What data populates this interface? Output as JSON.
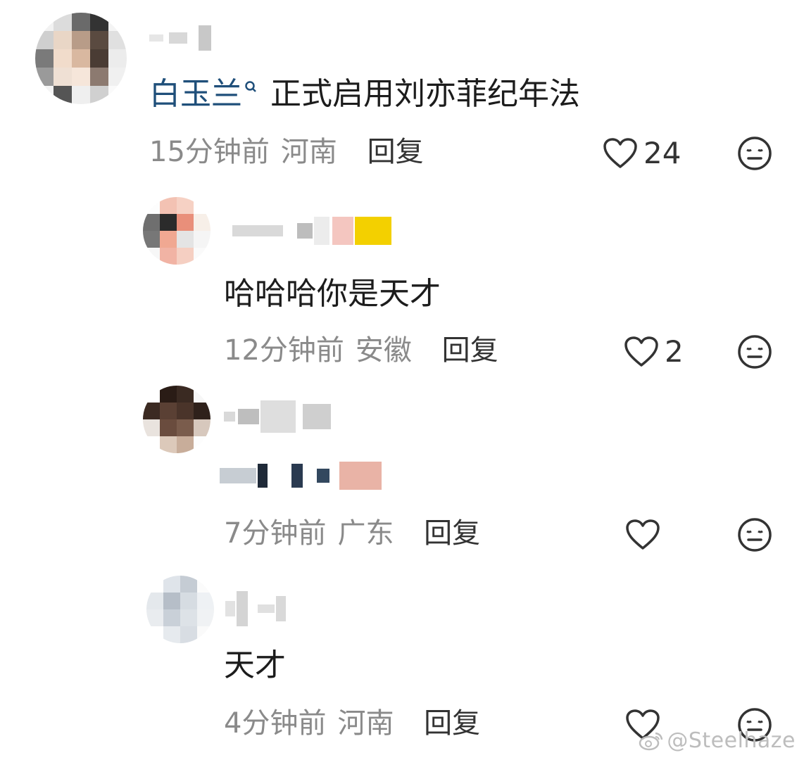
{
  "comments": [
    {
      "mention": "白玉兰",
      "text": "正式启用刘亦菲纪年法",
      "time": "15分钟前",
      "location": "河南",
      "reply_label": "回复",
      "likes": "24"
    },
    {
      "text": "哈哈哈你是天才",
      "time": "12分钟前",
      "location": "安徽",
      "reply_label": "回复",
      "likes": "2"
    },
    {
      "text": "",
      "time": "7分钟前",
      "location": "广东",
      "reply_label": "回复",
      "likes": ""
    },
    {
      "text": "天才",
      "time": "4分钟前",
      "location": "河南",
      "reply_label": "回复",
      "likes": ""
    }
  ],
  "watermark": "@Steelhaze",
  "icons": {
    "like": "heart-outline-icon",
    "dislike": "meh-face-icon",
    "mention": "search-icon",
    "watermark": "weibo-logo-icon"
  },
  "colors": {
    "mention": "#1f4f7a",
    "meta": "#8a8a8a",
    "text": "#1c1c1c"
  }
}
